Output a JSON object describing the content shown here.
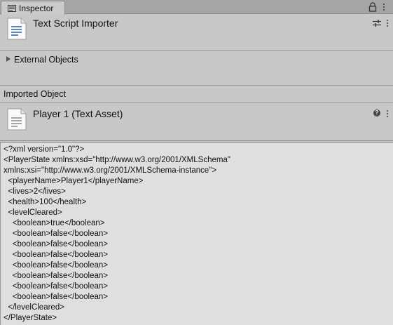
{
  "tab": {
    "label": "Inspector",
    "icon": "inspector-icon"
  },
  "toolbar": {
    "lock_icon": "lock-icon",
    "menu_icon": "kebab-menu-icon"
  },
  "importer": {
    "title": "Text Script Importer",
    "icon": "document-icon",
    "preset_icon": "sliders-icon"
  },
  "external_objects": {
    "label": "External Objects",
    "expanded": false
  },
  "imported_object": {
    "label": "Imported Object"
  },
  "asset": {
    "title": "Player 1 (Text Asset)",
    "icon": "document-icon",
    "help_icon": "help-icon",
    "help_glyph": "?"
  },
  "preview": {
    "lines": [
      "<?xml version=\"1.0\"?>",
      "<PlayerState xmlns:xsd=\"http://www.w3.org/2001/XMLSchema\"",
      "xmlns:xsi=\"http://www.w3.org/2001/XMLSchema-instance\">",
      "  <playerName>Player1</playerName>",
      "  <lives>2</lives>",
      "  <health>100</health>",
      "  <levelCleared>",
      "    <boolean>true</boolean>",
      "    <boolean>false</boolean>",
      "    <boolean>false</boolean>",
      "    <boolean>false</boolean>",
      "    <boolean>false</boolean>",
      "    <boolean>false</boolean>",
      "    <boolean>false</boolean>",
      "    <boolean>false</boolean>",
      "  </levelCleared>",
      "</PlayerState>"
    ]
  },
  "colors": {
    "panel_bg": "#c8c8c8",
    "tabbar_bg": "#a5a5a5",
    "preview_bg": "#dfdfdf",
    "icon_accent": "#2a5ea8"
  }
}
